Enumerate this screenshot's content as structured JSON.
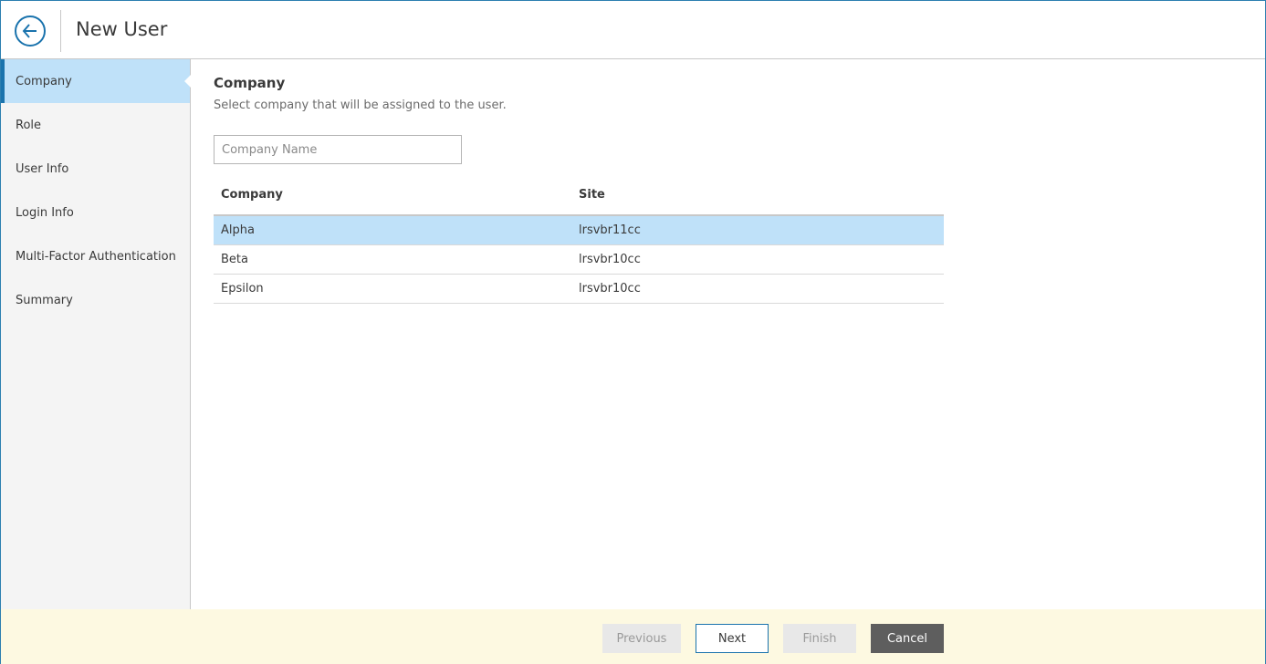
{
  "header": {
    "title": "New User",
    "back_icon": "arrow-left-circle-icon"
  },
  "sidebar": {
    "items": [
      {
        "label": "Company",
        "active": true
      },
      {
        "label": "Role",
        "active": false
      },
      {
        "label": "User Info",
        "active": false
      },
      {
        "label": "Login Info",
        "active": false
      },
      {
        "label": "Multi-Factor Authentication",
        "active": false
      },
      {
        "label": "Summary",
        "active": false
      }
    ]
  },
  "main": {
    "title": "Company",
    "description": "Select company that will be assigned to the user.",
    "search": {
      "placeholder": "Company Name",
      "value": ""
    },
    "table": {
      "columns": [
        "Company",
        "Site"
      ],
      "rows": [
        {
          "company": "Alpha",
          "site": "lrsvbr11cc",
          "selected": true
        },
        {
          "company": "Beta",
          "site": "lrsvbr10cc",
          "selected": false
        },
        {
          "company": "Epsilon",
          "site": "lrsvbr10cc",
          "selected": false
        }
      ]
    }
  },
  "footer": {
    "previous_label": "Previous",
    "next_label": "Next",
    "finish_label": "Finish",
    "cancel_label": "Cancel"
  },
  "colors": {
    "accent": "#1a73ad",
    "selection": "#bfe1f9",
    "footer_bg": "#fdf9e1",
    "cancel_bg": "#5e5e5e"
  }
}
